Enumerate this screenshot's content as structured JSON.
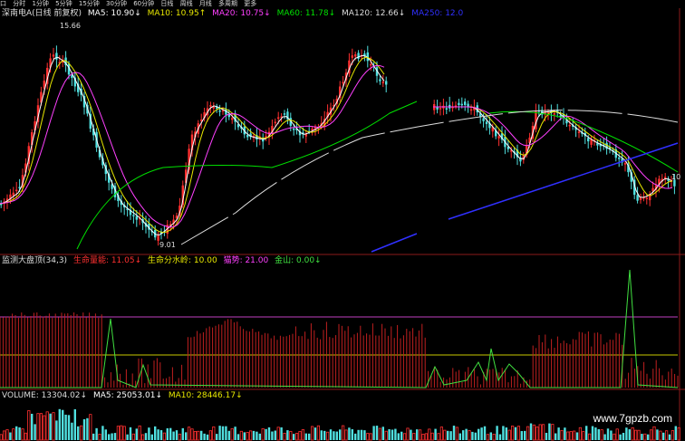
{
  "toolbar": {
    "items": [
      "口",
      "分时",
      "1分钟",
      "5分钟",
      "15分钟",
      "30分钟",
      "60分钟",
      "日线",
      "周线",
      "月线",
      "多周期",
      "更多"
    ]
  },
  "main_legend": {
    "name": "深南电A(日线 前复权)",
    "ma5": "MA5: 10.90↓",
    "ma10": "MA10: 10.95↑",
    "ma20": "MA20: 10.75↓",
    "ma60": "MA60: 11.78↓",
    "ma120": "MA120: 12.66↓",
    "ma250": "MA250: 12.0"
  },
  "price_marks": {
    "high": "15.66",
    "low": "9.01",
    "right": "10"
  },
  "indicator_legend": {
    "name": "监测大盘顶(34,3)",
    "life_line": "生命量能: 11.05↓",
    "watershed": "生命分水岭: 10.00",
    "trend": "猫势: 21.00",
    "gold": "金山: 0.00↓"
  },
  "volume_legend": {
    "volume": "VOLUME: 13304.02↓",
    "ma5": "MA5: 25053.01↓",
    "ma10": "MA10: 28446.17↓"
  },
  "watermark": "www.7gpzb.com",
  "colors": {
    "ma5": "#ffffff",
    "ma10": "#e8e800",
    "ma20": "#ff40ff",
    "ma60": "#00e000",
    "ma120": "#dddddd",
    "ma250": "#3030ff",
    "up": "#ff3030",
    "down": "#50e0e0",
    "indicator_bar": "#c02020",
    "green_line": "#40e040",
    "purple_line": "#c040c0",
    "yellow_line": "#c8c800"
  }
}
